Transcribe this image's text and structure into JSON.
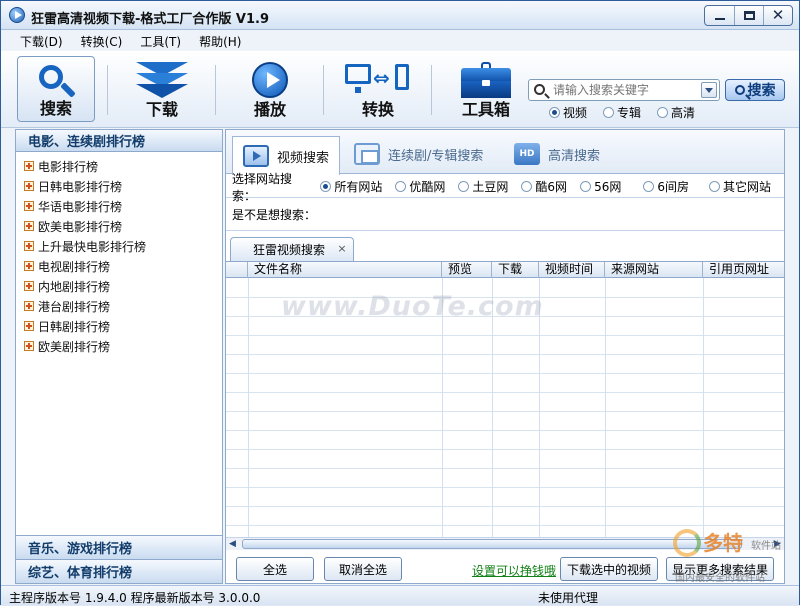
{
  "window": {
    "title": "狂雷高清视频下载-格式工厂合作版 V1.9"
  },
  "menu": [
    "下载(D)",
    "转换(C)",
    "工具(T)",
    "帮助(H)"
  ],
  "toolbar": {
    "search": "搜索",
    "download": "下载",
    "play": "播放",
    "convert": "转换",
    "toolbox": "工具箱"
  },
  "search": {
    "placeholder": "请输入搜索关键字",
    "button": "搜索",
    "types": [
      "视频",
      "专辑",
      "高清"
    ],
    "selected_type": "视频"
  },
  "left_panel": {
    "header": "电影、连续剧排行榜",
    "items": [
      "电影排行榜",
      "日韩电影排行榜",
      "华语电影排行榜",
      "欧美电影排行榜",
      "上升最快电影排行榜",
      "电视剧排行榜",
      "内地剧排行榜",
      "港台剧排行榜",
      "日韩剧排行榜",
      "欧美剧排行榜"
    ],
    "bottom_headers": [
      "音乐、游戏排行榜",
      "综艺、体育排行榜"
    ]
  },
  "tabs": [
    "视频搜索",
    "连续剧/专辑搜索",
    "高清搜索"
  ],
  "hd_icon_text": "HD",
  "site_filter": {
    "label": "选择网站搜索：",
    "options": [
      "所有网站",
      "优酷网",
      "土豆网",
      "酷6网",
      "56网",
      "6间房",
      "其它网站"
    ],
    "selected": "所有网站"
  },
  "suggest": {
    "label": "是不是想搜索："
  },
  "result_tab": {
    "label": "狂雷视频搜索",
    "close": "×"
  },
  "table": {
    "columns": [
      "文件名称",
      "预览",
      "下载",
      "视频时间",
      "来源网站",
      "引用页网址"
    ]
  },
  "actions": {
    "select_all": "全选",
    "deselect_all": "取消全选",
    "settings_link": "设置可以挣钱哦",
    "download_selected": "下载选中的视频",
    "show_more": "显示更多搜索结果"
  },
  "status": {
    "left": "主程序版本号 1.9.4.0  程序最新版本号 3.0.0.0",
    "right": "未使用代理"
  },
  "watermark": {
    "text": "www.DuoTe.com",
    "logo_big": "多特",
    "logo_small": "软件站",
    "logo_tagline": "国内最安全的软件站"
  }
}
